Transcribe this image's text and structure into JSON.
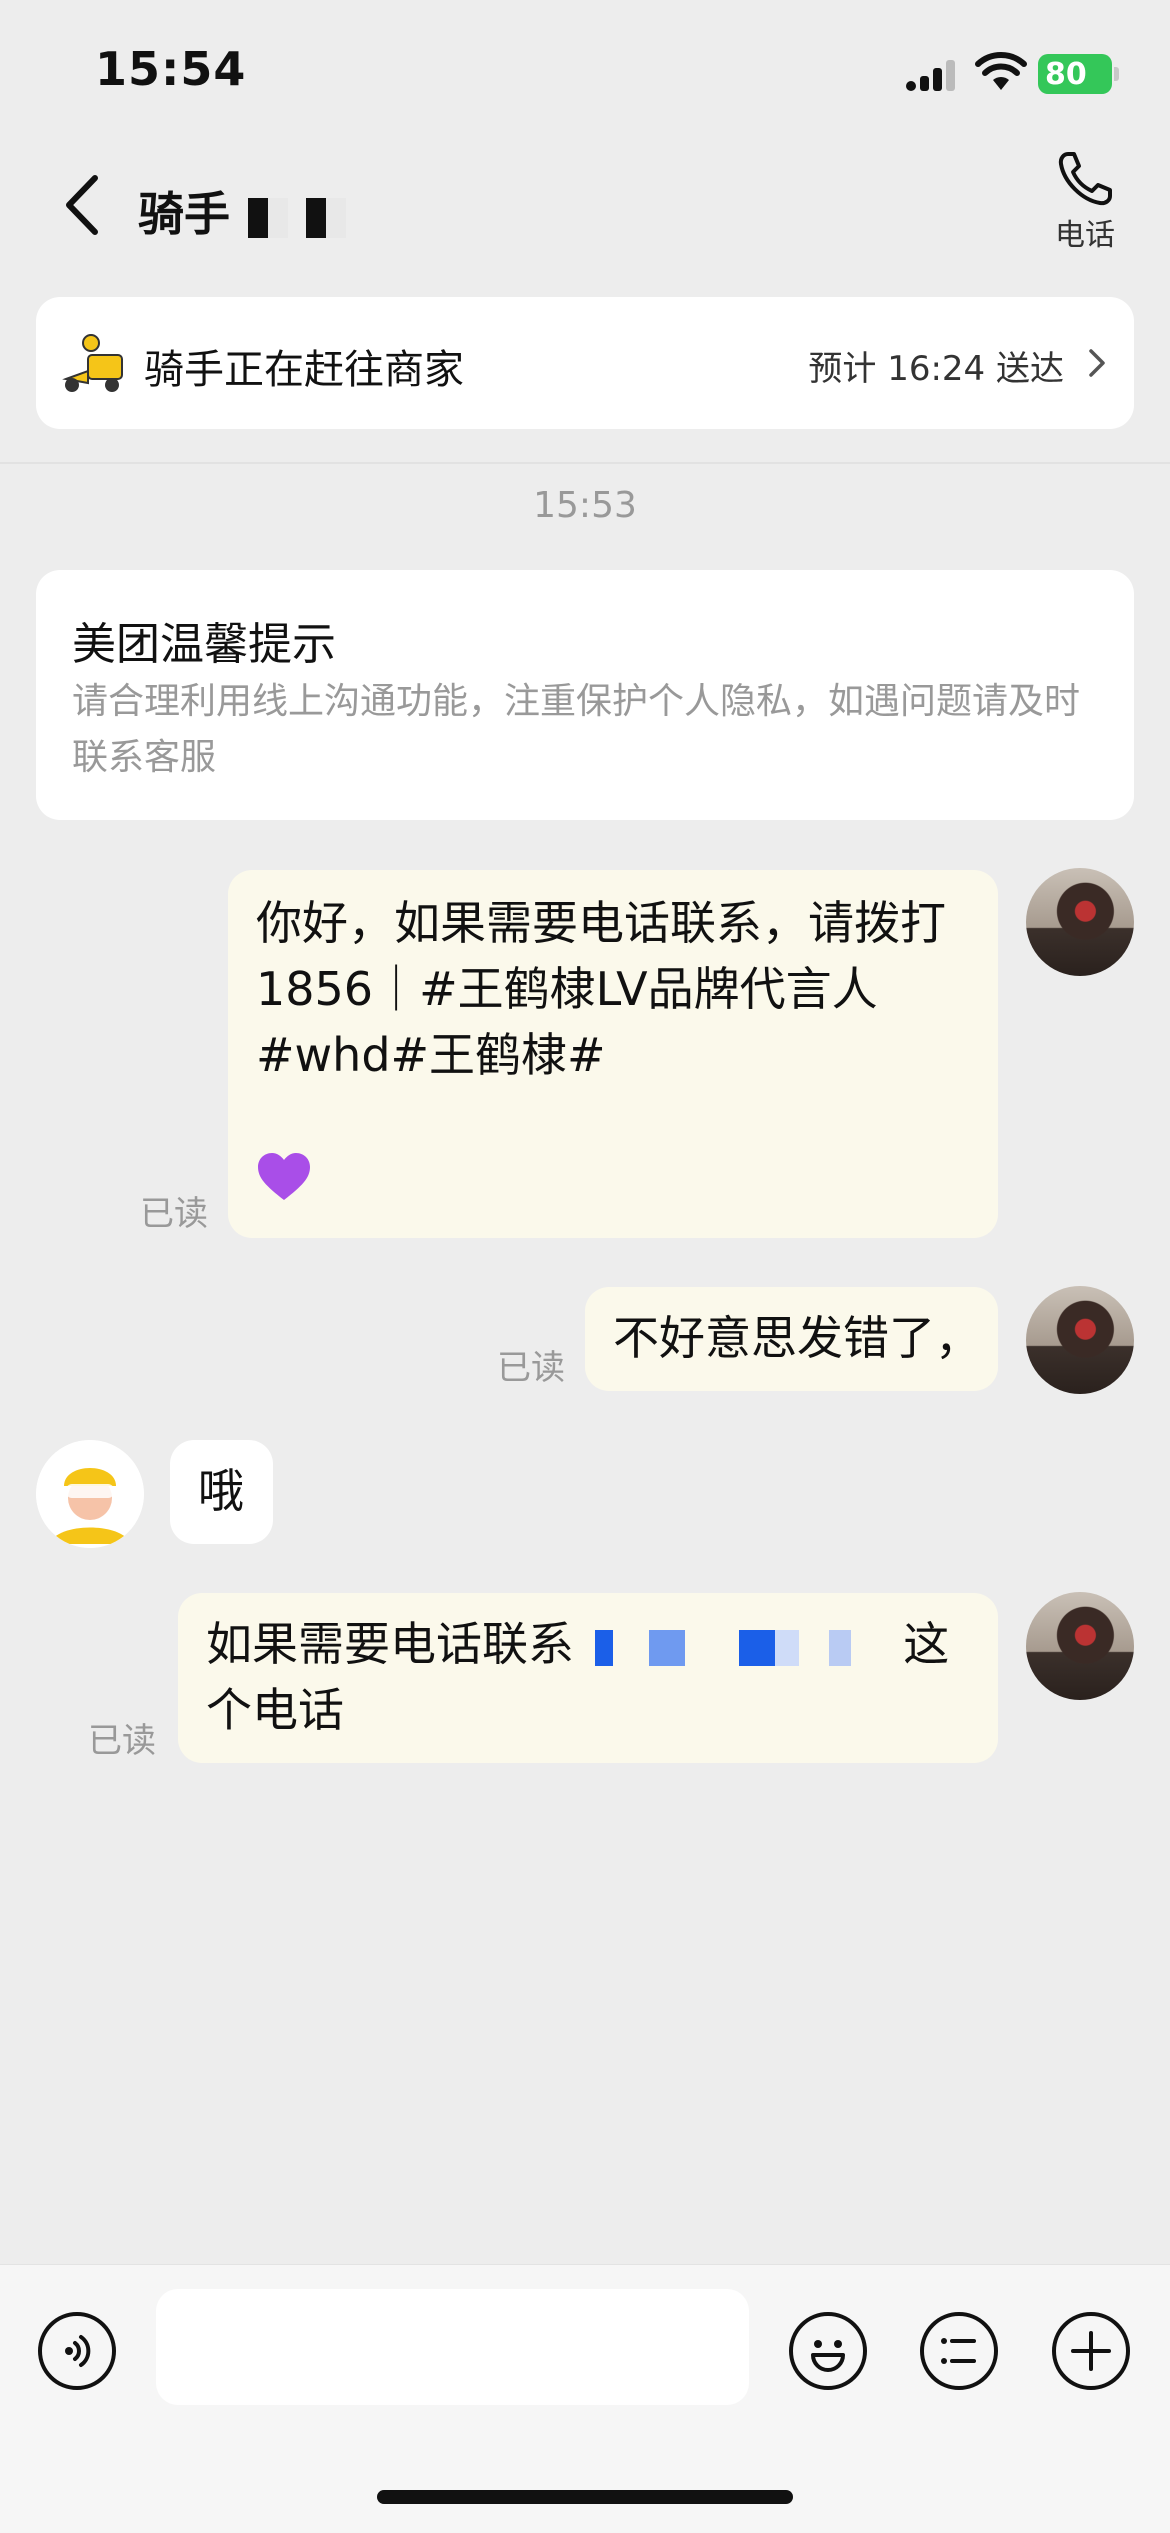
{
  "status_bar": {
    "time": "15:54",
    "battery": "80"
  },
  "nav": {
    "title": "骑手",
    "call_label": "电话"
  },
  "rider_card": {
    "status": "骑手正在赶往商家",
    "eta": "预计 16:24 送达"
  },
  "timestamp": "15:53",
  "notice": {
    "title": "美团温馨提示",
    "body": "请合理利用线上沟通功能，注重保护个人隐私，如遇问题请及时联系客服"
  },
  "messages": [
    {
      "from": "me",
      "line1": "你好，如果需要电话联系，请拨打",
      "line2": "1856｜#王鹤棣LV品牌代言人",
      "line3": "#whd#王鹤棣#",
      "emoji": "purple-heart",
      "read": "已读"
    },
    {
      "from": "me",
      "text": "不好意思发错了，",
      "read": "已读"
    },
    {
      "from": "rider",
      "text": "哦"
    },
    {
      "from": "me",
      "text_start": "如果需要电话联系",
      "text_end": "这",
      "line2": "个电话",
      "read": "已读"
    }
  ],
  "input": {
    "placeholder": ""
  },
  "icons": [
    "back-icon",
    "phone-icon",
    "rider-scooter-icon",
    "chevron-right-icon",
    "voice-icon",
    "emoji-icon",
    "quick-reply-icon",
    "plus-icon"
  ],
  "colors": {
    "background": "#ededed",
    "my_bubble": "#fbf9eb",
    "battery": "#34c759",
    "muted_text": "#999999"
  }
}
